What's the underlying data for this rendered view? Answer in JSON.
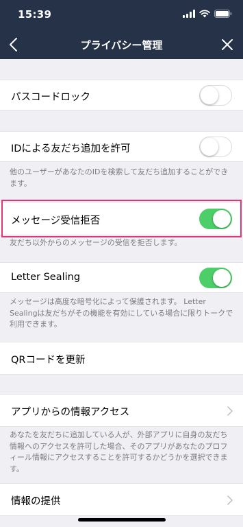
{
  "status_bar": {
    "time": "15:39"
  },
  "nav": {
    "title": "プライバシー管理"
  },
  "rows": {
    "passcode_lock": {
      "label": "パスコードロック",
      "enabled": false
    },
    "add_by_id": {
      "label": "IDによる友だち追加を許可",
      "enabled": false,
      "description": "他のユーザーがあなたのIDを検索して友だち追加することができます。"
    },
    "block_messages": {
      "label": "メッセージ受信拒否",
      "enabled": true,
      "description": "友だち以外からのメッセージの受信を拒否します。"
    },
    "letter_sealing": {
      "label": "Letter Sealing",
      "enabled": true,
      "description": "メッセージは高度な暗号化によって保護されます。 Letter Sealingは友だちがその機能を有効にしている場合に限りトークで利用できます。"
    },
    "qr_update": {
      "label": "QRコードを更新"
    },
    "app_info_access": {
      "label": "アプリからの情報アクセス",
      "description": "あなたを友だちに追加している人が、外部アプリに自身の友だち情報へのアクセスを許可した場合、そのアプリがあなたのプロフィール情報にアクセスすることを許可するかどうかを選択できます。"
    },
    "info_provision": {
      "label": "情報の提供"
    }
  },
  "colors": {
    "header_bg": "#253247",
    "toggle_on": "#4ccf68",
    "highlight_border": "#e5337a",
    "background": "#efeff4"
  },
  "icons": {
    "back": "chevron-left-icon",
    "close": "close-icon",
    "row_disclosure": "chevron-right-icon"
  }
}
